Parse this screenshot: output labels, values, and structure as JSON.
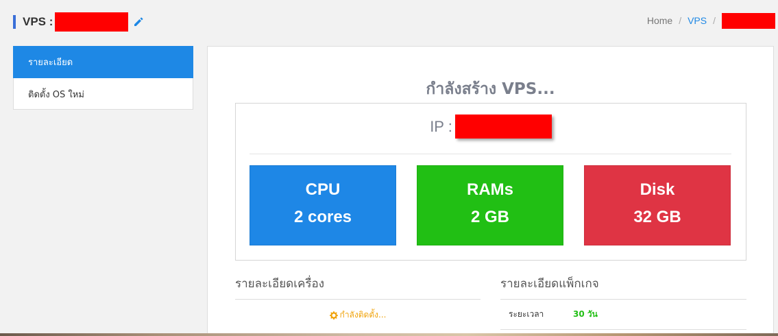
{
  "header": {
    "title": "VPS :",
    "breadcrumb": {
      "home": "Home",
      "vps": "VPS",
      "separator": "/"
    }
  },
  "sidebar": {
    "items": [
      {
        "label": "รายละเอียด",
        "active": true
      },
      {
        "label": "ติดตั้ง OS ใหม่",
        "active": false
      }
    ]
  },
  "main": {
    "status_title": "กำลังสร้าง VPS...",
    "ip_label": "IP :",
    "specs": {
      "cpu": {
        "name": "CPU",
        "value": "2 cores"
      },
      "ram": {
        "name": "RAMs",
        "value": "2 GB"
      },
      "disk": {
        "name": "Disk",
        "value": "32 GB"
      }
    },
    "machine_details": {
      "heading": "รายละเอียดเครื่อง",
      "status": "กำลังติดตั้ง..."
    },
    "package_details": {
      "heading": "รายละเอียดแพ็กเกจ",
      "rows": [
        {
          "label": "ระยะเวลา",
          "value": "30 วัน"
        }
      ]
    }
  },
  "colors": {
    "primary": "#1e88e5",
    "cpu": "#1e87e6",
    "ram": "#21bf14",
    "disk": "#df3444",
    "warning": "#f0a30a",
    "redacted": "#ff0000"
  }
}
